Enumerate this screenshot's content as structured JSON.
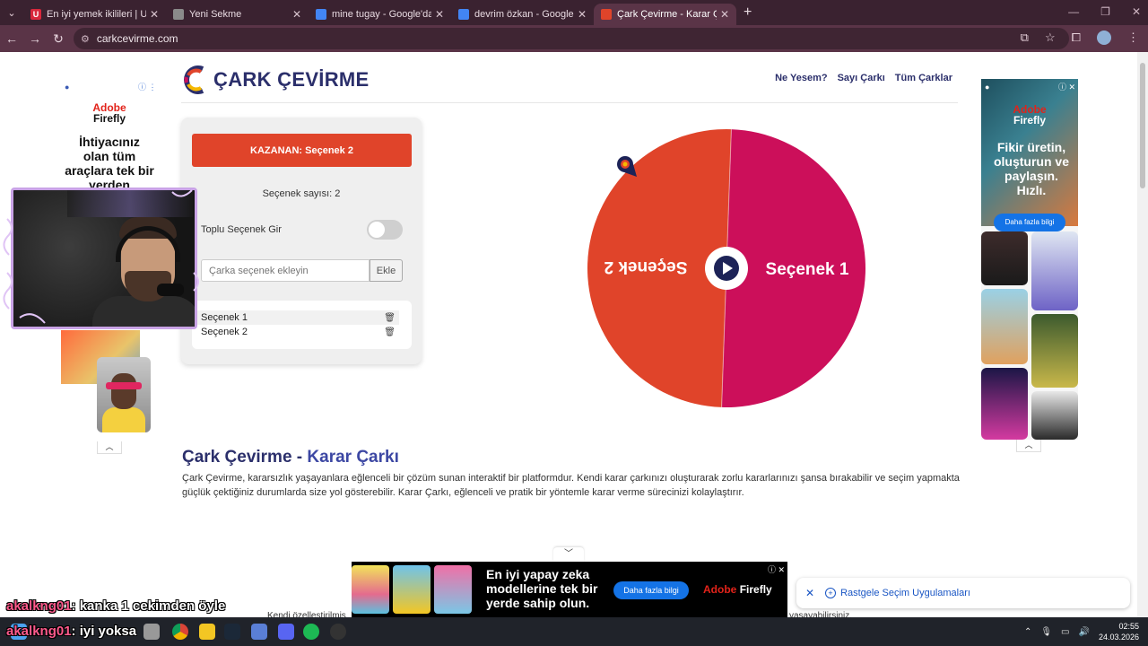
{
  "browser": {
    "tabs": [
      {
        "label": "En iyi yemek ikilileri | UwUFUFU",
        "fav_color": "#d9283c",
        "fav_letter": "U"
      },
      {
        "label": "Yeni Sekme",
        "fav_color": "#8a8a8a",
        "fav_letter": ""
      },
      {
        "label": "mine tugay - Google'da Ara",
        "fav_color": "#4285f4",
        "fav_letter": ""
      },
      {
        "label": "devrim özkan - Google'da Ara",
        "fav_color": "#4285f4",
        "fav_letter": ""
      },
      {
        "label": "Çark Çevirme - Karar Çarkı",
        "fav_color": "#e0442a",
        "fav_letter": ""
      }
    ],
    "url": "carkcevirme.com"
  },
  "site": {
    "brand": "ÇARK ÇEVİRME",
    "nav": [
      "Ne Yesem?",
      "Sayı Çarkı",
      "Tüm Çarklar"
    ]
  },
  "panel": {
    "winner_label": "KAZANAN: Seçenek 2",
    "count_label": "Seçenek sayısı: 2",
    "bulk_label": "Toplu Seçenek Gir",
    "input_placeholder": "Çarka seçenek ekleyin",
    "add_label": "Ekle",
    "options": [
      "Seçenek 1",
      "Seçenek 2"
    ]
  },
  "wheel": {
    "segments": [
      {
        "label": "Seçenek 1",
        "color": "#cc0f5a"
      },
      {
        "label": "Seçenek 2",
        "color": "#e0442a"
      }
    ]
  },
  "content": {
    "title_main": "Çark Çevirme - ",
    "title_accent": "Karar Çarkı",
    "paragraph": "Çark Çevirme, kararsızlık yaşayanlara eğlenceli bir çözüm sunan interaktif bir platformdur. Kendi karar çarkınızı oluşturarak zorlu kararlarınızı şansa bırakabilir ve seçim yapmakta güçlük çektiğiniz durumlarda size yol gösterebilir. Karar Çarkı, eğlenceli ve pratik bir yöntemle karar verme sürecinizi kolaylaştırır."
  },
  "ad_left": {
    "brand_line1": "Adobe",
    "brand_line2": "Firefly",
    "headline": "İhtiyacınız olan tüm araçlara tek bir yerden"
  },
  "ad_right": {
    "brand_line1": "Adobe",
    "brand_line2": "Firefly",
    "headline": "Fikir üretin, oluşturun ve paylaşın. Hızlı.",
    "button": "Daha fazla bilgi"
  },
  "ad_bottom": {
    "headline": "En iyi yapay zeka modellerine tek bir yerde sahip olun.",
    "button": "Daha fazla bilgi",
    "brand_a": "Adobe",
    "brand_b": "Firefly"
  },
  "snackbar": {
    "label": "Rastgele Seçim Uygulamaları"
  },
  "partial_text": {
    "left": "Kendi özelleştirilmiş",
    "right": "yaşayabilirsiniz."
  },
  "chat": [
    {
      "user": "akalkng01",
      "msg": ": kanka 1 cekimden öyle"
    },
    {
      "user": "akalkng01",
      "msg": ": iyi yoksa"
    }
  ],
  "taskbar": {
    "time": "02:55",
    "date": "24.03.2026"
  }
}
